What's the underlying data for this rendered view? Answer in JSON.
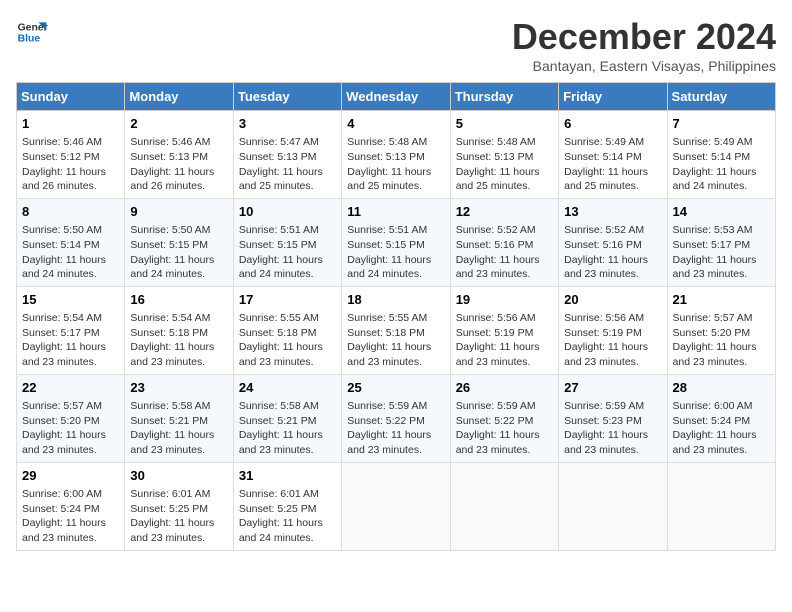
{
  "logo": {
    "line1": "General",
    "line2": "Blue"
  },
  "title": "December 2024",
  "subtitle": "Bantayan, Eastern Visayas, Philippines",
  "weekdays": [
    "Sunday",
    "Monday",
    "Tuesday",
    "Wednesday",
    "Thursday",
    "Friday",
    "Saturday"
  ],
  "weeks": [
    [
      {
        "day": "1",
        "info": "Sunrise: 5:46 AM\nSunset: 5:12 PM\nDaylight: 11 hours\nand 26 minutes."
      },
      {
        "day": "2",
        "info": "Sunrise: 5:46 AM\nSunset: 5:13 PM\nDaylight: 11 hours\nand 26 minutes."
      },
      {
        "day": "3",
        "info": "Sunrise: 5:47 AM\nSunset: 5:13 PM\nDaylight: 11 hours\nand 25 minutes."
      },
      {
        "day": "4",
        "info": "Sunrise: 5:48 AM\nSunset: 5:13 PM\nDaylight: 11 hours\nand 25 minutes."
      },
      {
        "day": "5",
        "info": "Sunrise: 5:48 AM\nSunset: 5:13 PM\nDaylight: 11 hours\nand 25 minutes."
      },
      {
        "day": "6",
        "info": "Sunrise: 5:49 AM\nSunset: 5:14 PM\nDaylight: 11 hours\nand 25 minutes."
      },
      {
        "day": "7",
        "info": "Sunrise: 5:49 AM\nSunset: 5:14 PM\nDaylight: 11 hours\nand 24 minutes."
      }
    ],
    [
      {
        "day": "8",
        "info": "Sunrise: 5:50 AM\nSunset: 5:14 PM\nDaylight: 11 hours\nand 24 minutes."
      },
      {
        "day": "9",
        "info": "Sunrise: 5:50 AM\nSunset: 5:15 PM\nDaylight: 11 hours\nand 24 minutes."
      },
      {
        "day": "10",
        "info": "Sunrise: 5:51 AM\nSunset: 5:15 PM\nDaylight: 11 hours\nand 24 minutes."
      },
      {
        "day": "11",
        "info": "Sunrise: 5:51 AM\nSunset: 5:15 PM\nDaylight: 11 hours\nand 24 minutes."
      },
      {
        "day": "12",
        "info": "Sunrise: 5:52 AM\nSunset: 5:16 PM\nDaylight: 11 hours\nand 23 minutes."
      },
      {
        "day": "13",
        "info": "Sunrise: 5:52 AM\nSunset: 5:16 PM\nDaylight: 11 hours\nand 23 minutes."
      },
      {
        "day": "14",
        "info": "Sunrise: 5:53 AM\nSunset: 5:17 PM\nDaylight: 11 hours\nand 23 minutes."
      }
    ],
    [
      {
        "day": "15",
        "info": "Sunrise: 5:54 AM\nSunset: 5:17 PM\nDaylight: 11 hours\nand 23 minutes."
      },
      {
        "day": "16",
        "info": "Sunrise: 5:54 AM\nSunset: 5:18 PM\nDaylight: 11 hours\nand 23 minutes."
      },
      {
        "day": "17",
        "info": "Sunrise: 5:55 AM\nSunset: 5:18 PM\nDaylight: 11 hours\nand 23 minutes."
      },
      {
        "day": "18",
        "info": "Sunrise: 5:55 AM\nSunset: 5:18 PM\nDaylight: 11 hours\nand 23 minutes."
      },
      {
        "day": "19",
        "info": "Sunrise: 5:56 AM\nSunset: 5:19 PM\nDaylight: 11 hours\nand 23 minutes."
      },
      {
        "day": "20",
        "info": "Sunrise: 5:56 AM\nSunset: 5:19 PM\nDaylight: 11 hours\nand 23 minutes."
      },
      {
        "day": "21",
        "info": "Sunrise: 5:57 AM\nSunset: 5:20 PM\nDaylight: 11 hours\nand 23 minutes."
      }
    ],
    [
      {
        "day": "22",
        "info": "Sunrise: 5:57 AM\nSunset: 5:20 PM\nDaylight: 11 hours\nand 23 minutes."
      },
      {
        "day": "23",
        "info": "Sunrise: 5:58 AM\nSunset: 5:21 PM\nDaylight: 11 hours\nand 23 minutes."
      },
      {
        "day": "24",
        "info": "Sunrise: 5:58 AM\nSunset: 5:21 PM\nDaylight: 11 hours\nand 23 minutes."
      },
      {
        "day": "25",
        "info": "Sunrise: 5:59 AM\nSunset: 5:22 PM\nDaylight: 11 hours\nand 23 minutes."
      },
      {
        "day": "26",
        "info": "Sunrise: 5:59 AM\nSunset: 5:22 PM\nDaylight: 11 hours\nand 23 minutes."
      },
      {
        "day": "27",
        "info": "Sunrise: 5:59 AM\nSunset: 5:23 PM\nDaylight: 11 hours\nand 23 minutes."
      },
      {
        "day": "28",
        "info": "Sunrise: 6:00 AM\nSunset: 5:24 PM\nDaylight: 11 hours\nand 23 minutes."
      }
    ],
    [
      {
        "day": "29",
        "info": "Sunrise: 6:00 AM\nSunset: 5:24 PM\nDaylight: 11 hours\nand 23 minutes."
      },
      {
        "day": "30",
        "info": "Sunrise: 6:01 AM\nSunset: 5:25 PM\nDaylight: 11 hours\nand 23 minutes."
      },
      {
        "day": "31",
        "info": "Sunrise: 6:01 AM\nSunset: 5:25 PM\nDaylight: 11 hours\nand 24 minutes."
      },
      {
        "day": "",
        "info": ""
      },
      {
        "day": "",
        "info": ""
      },
      {
        "day": "",
        "info": ""
      },
      {
        "day": "",
        "info": ""
      }
    ]
  ]
}
